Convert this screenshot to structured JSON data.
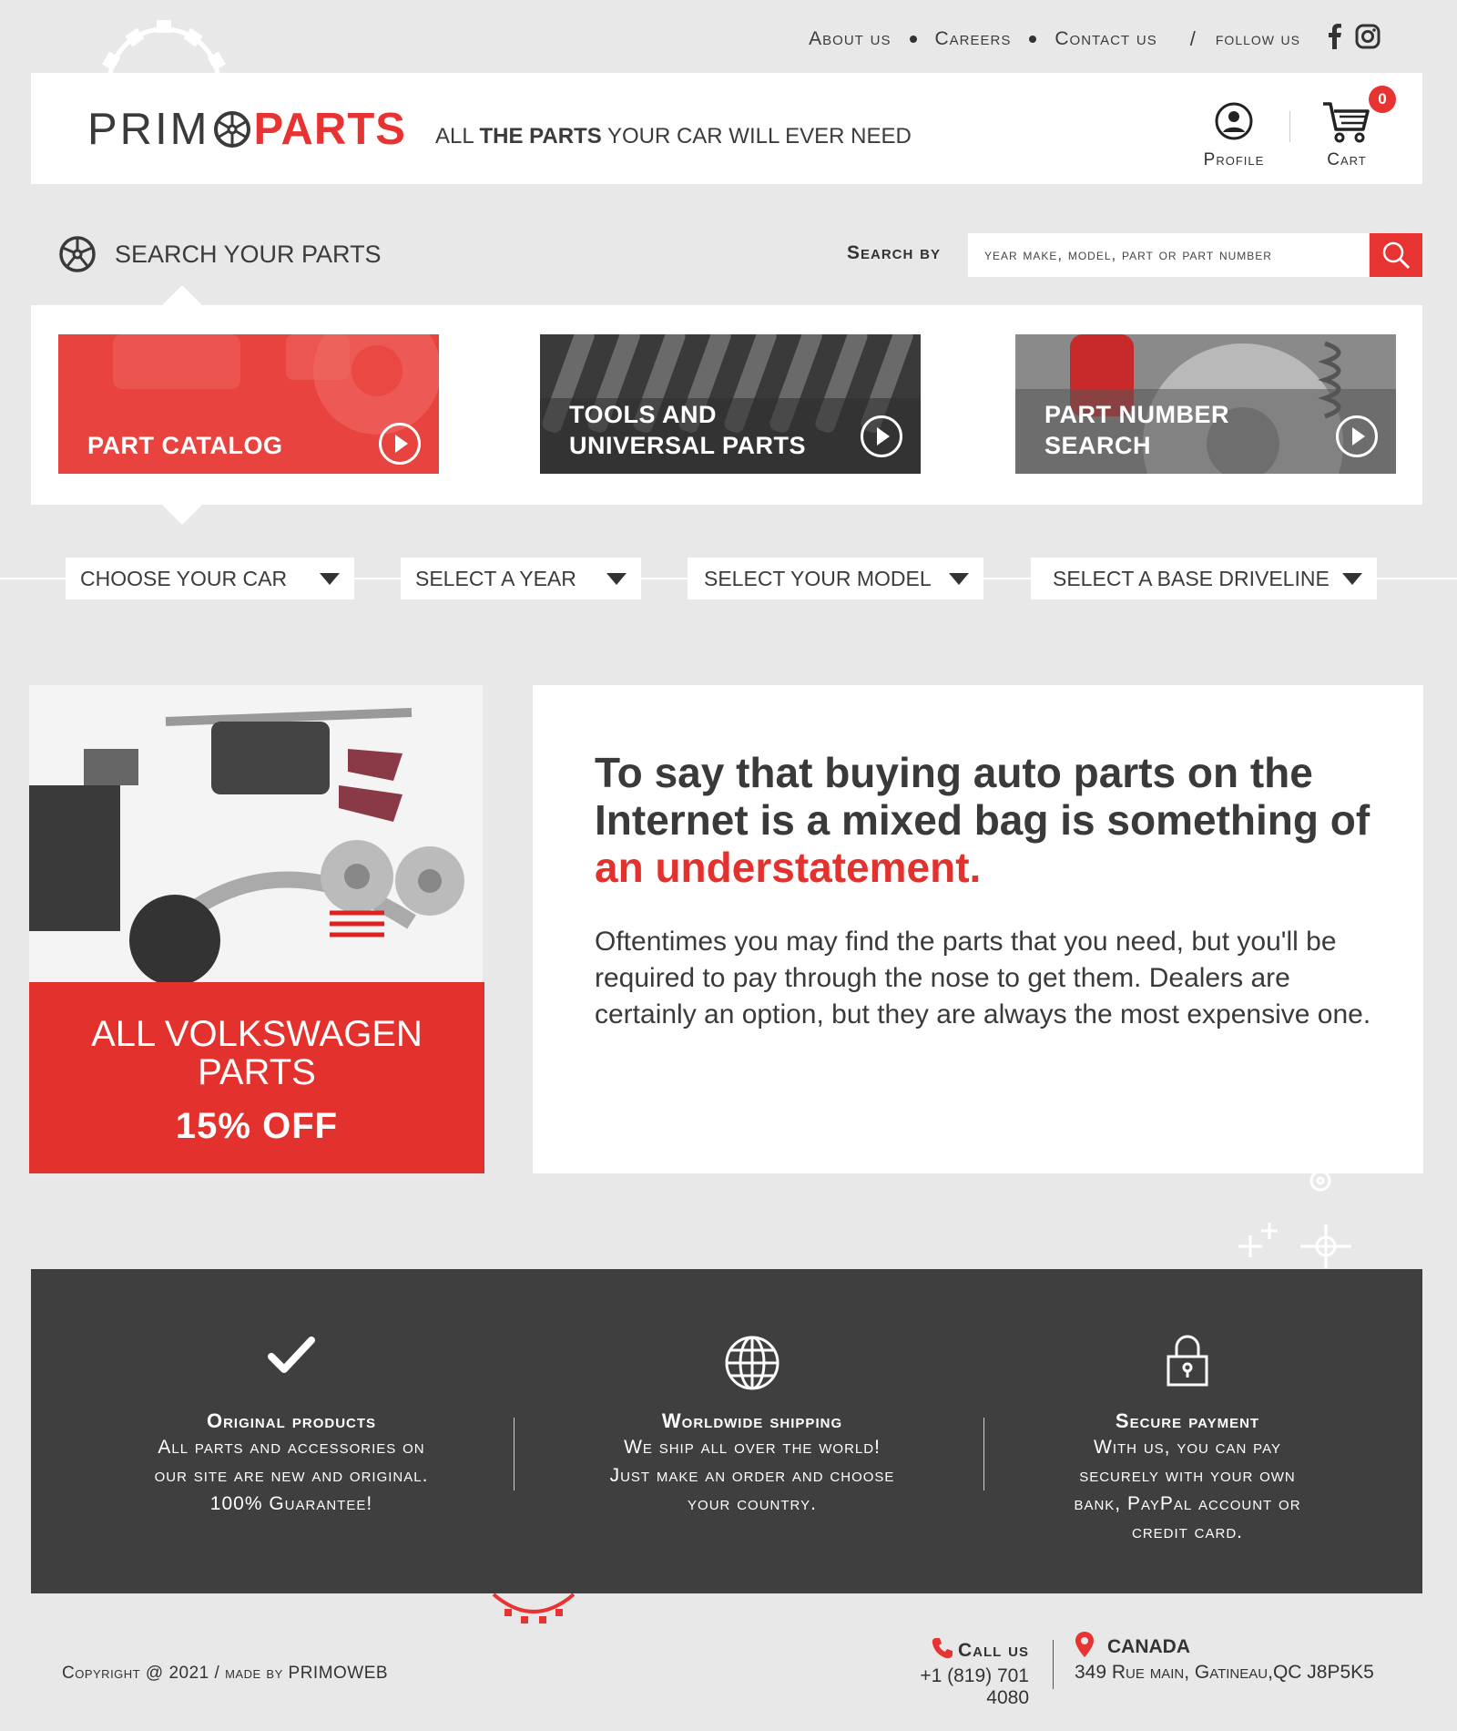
{
  "nav": {
    "about": "About us",
    "careers": "Careers",
    "contact": "Contact us",
    "separator": "/",
    "follow": "follow us"
  },
  "header": {
    "logo_left": "PRIM",
    "logo_right": "PARTS",
    "tagline_1": "ALL ",
    "tagline_2": "THE PARTS",
    "tagline_3": " YOUR CAR  WILL EVER NEED",
    "profile_label": "Profile",
    "cart_label": "Cart",
    "cart_count": "0"
  },
  "search": {
    "title": "SEARCH YOUR PARTS",
    "by_label": "Search by",
    "placeholder": "year make, model, part or part number"
  },
  "categories": [
    {
      "label_1": "PART  CATALOG",
      "label_2": ""
    },
    {
      "label_1": "TOOLS AND",
      "label_2": "UNIVERSAL PARTS"
    },
    {
      "label_1": "PART NUMBER",
      "label_2": "SEARCH"
    }
  ],
  "selectors": [
    "CHOOSE YOUR CAR",
    "SELECT A YEAR",
    "SELECT YOUR MODEL",
    "SELECT A BASE DRIVELINE"
  ],
  "promo": {
    "title": "ALL VOLKSWAGEN PARTS",
    "discount": "15% OFF"
  },
  "article": {
    "headline": "To say that buying auto parts on the Internet is a mixed bag is something of ",
    "headline_highlight": "an understatement.",
    "body": "Oftentimes you may find the parts that you need, but you'll be required to pay through the nose to get them. Dealers are certainly an option, but they are always the most expensive one."
  },
  "features": [
    {
      "icon": "checkmark-icon",
      "title": "Original products",
      "line_1": "All parts and accessories on",
      "line_2": "our site are new and original.",
      "line_3": "100% Guarantee!",
      "line_4": ""
    },
    {
      "icon": "globe-icon",
      "title": "Worldwide shipping",
      "line_1": "We ship all over the world!",
      "line_2": "Just make an order and choose",
      "line_3": "your country.",
      "line_4": ""
    },
    {
      "icon": "lock-icon",
      "title": "Secure payment",
      "line_1": "With us, you can pay",
      "line_2": "securely with your own",
      "line_3": "bank, PayPal account or",
      "line_4": "credit card."
    }
  ],
  "footer": {
    "copyright": "Copyright @ 2021 /  made by PRIMOWEB",
    "call_label": "Call us",
    "phone": "+1 (819) 701 4080",
    "country": "CANADA",
    "address": "349 Rue main, Gatineau,QC J8P5K5"
  },
  "colors": {
    "accent": "#e73331",
    "background": "#e8e8e9",
    "dark": "#3f3f3f"
  }
}
